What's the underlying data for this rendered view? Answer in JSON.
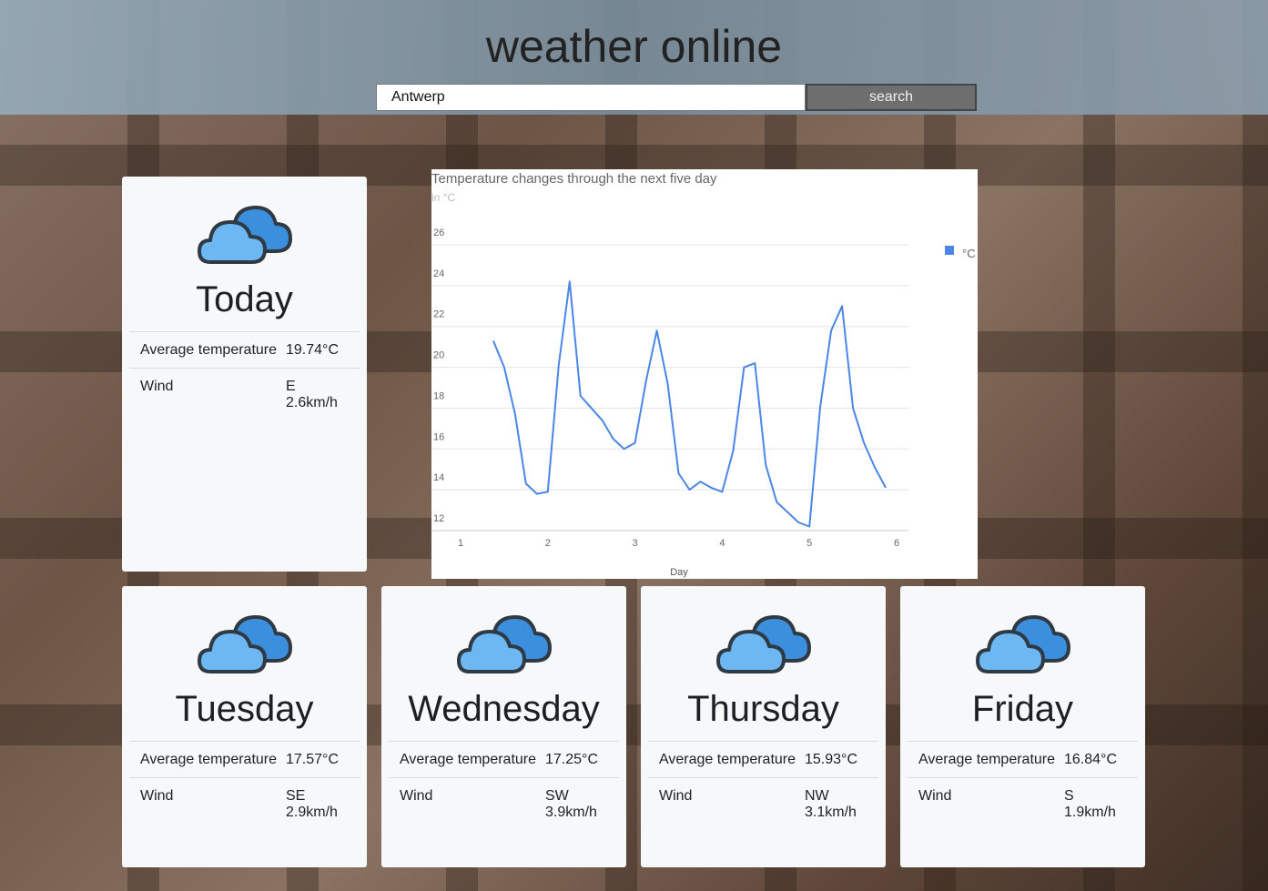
{
  "app": {
    "title": "weather online"
  },
  "search": {
    "value": "Antwerp",
    "button_label": "search"
  },
  "today": {
    "day": "Today",
    "avg_label": "Average temperature",
    "avg_value": "19.74°C",
    "wind_label": "Wind",
    "wind_dir": "E",
    "wind_speed": "2.6km/h",
    "icon": "cloudy-icon"
  },
  "forecast": [
    {
      "day": "Tuesday",
      "avg_label": "Average temperature",
      "avg_value": "17.57°C",
      "wind_label": "Wind",
      "wind_dir": "SE",
      "wind_speed": "2.9km/h",
      "icon": "cloudy-icon"
    },
    {
      "day": "Wednesday",
      "avg_label": "Average temperature",
      "avg_value": "17.25°C",
      "wind_label": "Wind",
      "wind_dir": "SW",
      "wind_speed": "3.9km/h",
      "icon": "cloudy-icon"
    },
    {
      "day": "Thursday",
      "avg_label": "Average temperature",
      "avg_value": "15.93°C",
      "wind_label": "Wind",
      "wind_dir": "NW",
      "wind_speed": "3.1km/h",
      "icon": "cloudy-icon"
    },
    {
      "day": "Friday",
      "avg_label": "Average temperature",
      "avg_value": "16.84°C",
      "wind_label": "Wind",
      "wind_dir": "S",
      "wind_speed": "1.9km/h",
      "icon": "cloudy-icon"
    }
  ],
  "chart_data": {
    "type": "line",
    "title": "Temperature changes through the next five day",
    "subtitle": "in °C",
    "xlabel": "Day",
    "ylabel": "",
    "xlim": [
      1,
      6
    ],
    "ylim": [
      12,
      26
    ],
    "yticks": [
      12,
      14,
      16,
      18,
      20,
      22,
      24,
      26
    ],
    "xticks": [
      1,
      2,
      3,
      4,
      5,
      6
    ],
    "grid": true,
    "legend": "top-right",
    "series": [
      {
        "name": "°C",
        "color": "#4a86e8",
        "x": [
          1.375,
          1.5,
          1.625,
          1.75,
          1.875,
          2.0,
          2.125,
          2.25,
          2.375,
          2.5,
          2.625,
          2.75,
          2.875,
          3.0,
          3.125,
          3.25,
          3.375,
          3.5,
          3.625,
          3.75,
          3.875,
          4.0,
          4.125,
          4.25,
          4.375,
          4.5,
          4.625,
          4.75,
          4.875,
          5.0,
          5.125,
          5.25,
          5.375,
          5.5,
          5.625,
          5.75,
          5.875
        ],
        "values": [
          21.3,
          20.0,
          17.7,
          14.3,
          13.8,
          13.9,
          20.1,
          24.2,
          18.6,
          18.0,
          17.4,
          16.5,
          16.0,
          16.3,
          19.3,
          21.8,
          19.2,
          14.8,
          14.0,
          14.4,
          14.1,
          13.9,
          15.9,
          20.0,
          20.2,
          15.2,
          13.4,
          12.9,
          12.4,
          12.2,
          18.1,
          21.8,
          23.0,
          18.0,
          16.3,
          15.1,
          14.1
        ]
      }
    ]
  }
}
